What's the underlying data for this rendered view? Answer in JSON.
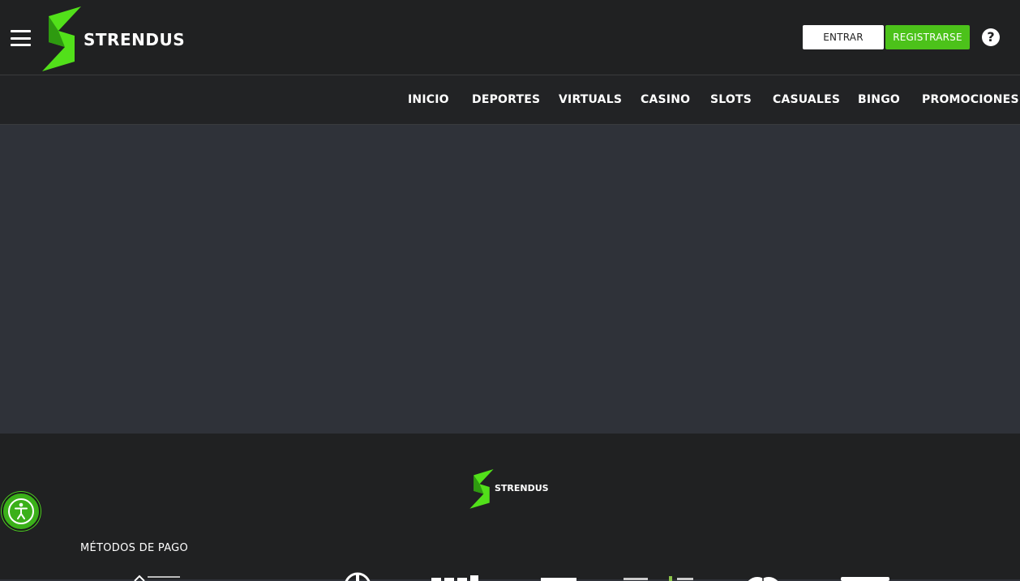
{
  "header": {
    "brand": "STRENDUS",
    "login_label": "ENTRAR",
    "register_label": "REGISTRARSE",
    "help_glyph": "?"
  },
  "nav": {
    "items": [
      {
        "label": "INICIO"
      },
      {
        "label": "DEPORTES"
      },
      {
        "label": "VIRTUALS"
      },
      {
        "label": "CASINO"
      },
      {
        "label": "SLOTS"
      },
      {
        "label": "CASUALES"
      },
      {
        "label": "BINGO"
      },
      {
        "label": "PROMOCIONES"
      }
    ]
  },
  "footer": {
    "brand": "STRENDUS",
    "payment_heading": "MÉTODOS DE PAGO"
  },
  "colors": {
    "accent_green": "#4cc21a",
    "header_bg": "#202122",
    "content_bg": "#2f3239"
  },
  "icons": {
    "menu": "hamburger-icon",
    "help": "help-icon",
    "accessibility": "accessibility-icon",
    "logo": "lightning-bolt-logo"
  }
}
